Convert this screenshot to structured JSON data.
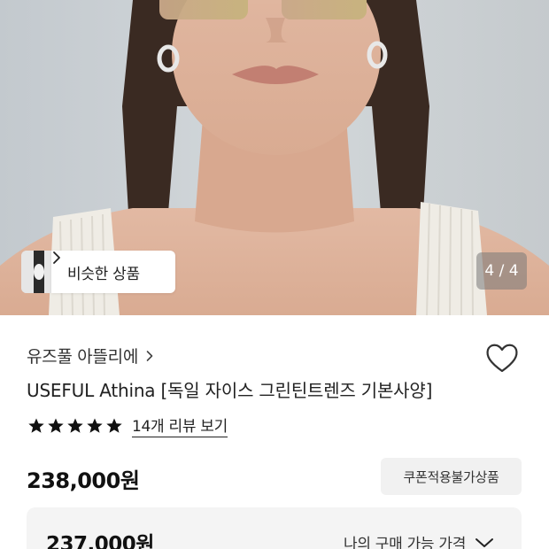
{
  "gallery": {
    "similar_label": "비슷한 상품",
    "counter_text": "4 / 4"
  },
  "product": {
    "brand": "유즈풀 아뜰리에",
    "title": "USEFUL Athina [독일 자이스 그린틴트렌즈 기본사양]",
    "rating": 5,
    "review_link": "14개 리뷰 보기",
    "price": "238,000원",
    "coupon_badge": "쿠폰적용불가상품"
  },
  "my_price": {
    "price": "237,000원",
    "label": "나의 구매 가능 가격"
  },
  "colors": {
    "background": "#ffffff",
    "star": "#111111",
    "badge_bg": "#f1f1f1",
    "box_bg": "#f4f4f4"
  }
}
